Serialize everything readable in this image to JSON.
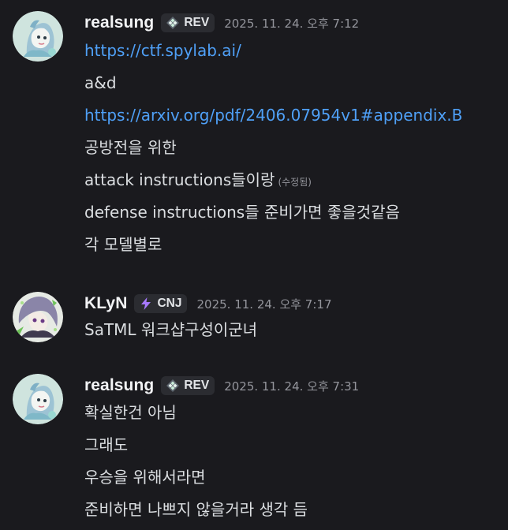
{
  "messages": [
    {
      "username": "realsung",
      "tag": "REV",
      "tag_icon": "diamond-grid-icon",
      "timestamp": "2025. 11. 24. 오후 7:12",
      "lines": [
        {
          "text": "https://ctf.spylab.ai/",
          "type": "link"
        },
        {
          "text": "a&d",
          "type": "text"
        },
        {
          "text": "https://arxiv.org/pdf/2406.07954v1#appendix.B",
          "type": "link"
        },
        {
          "text": "공방전을 위한",
          "type": "text"
        },
        {
          "text": "attack instructions들이랑",
          "type": "text",
          "edited": "(수정됨)"
        },
        {
          "text": "defense instructions들 준비가면 좋을것같음",
          "type": "text"
        },
        {
          "text": "각 모델별로",
          "type": "text"
        }
      ]
    },
    {
      "username": "KLyN",
      "tag": "CNJ",
      "tag_icon": "lightning-icon",
      "timestamp": "2025. 11. 24. 오후 7:17",
      "lines": [
        {
          "text": "SaTML 워크샵구성이군녀",
          "type": "text"
        }
      ]
    },
    {
      "username": "realsung",
      "tag": "REV",
      "tag_icon": "diamond-grid-icon",
      "timestamp": "2025. 11. 24. 오후 7:31",
      "lines": [
        {
          "text": "확실한건 아님",
          "type": "text"
        },
        {
          "text": "그래도",
          "type": "text"
        },
        {
          "text": "우승을 위해서라면",
          "type": "text"
        },
        {
          "text": "준비하면 나쁘지 않을거라 생각 듬",
          "type": "text"
        }
      ]
    }
  ],
  "colors": {
    "background": "#1a1a1e",
    "link": "#4fa0f7",
    "timestamp": "#94959c",
    "tag_bg": "#2b2c31",
    "lightning": "#a779ff"
  }
}
